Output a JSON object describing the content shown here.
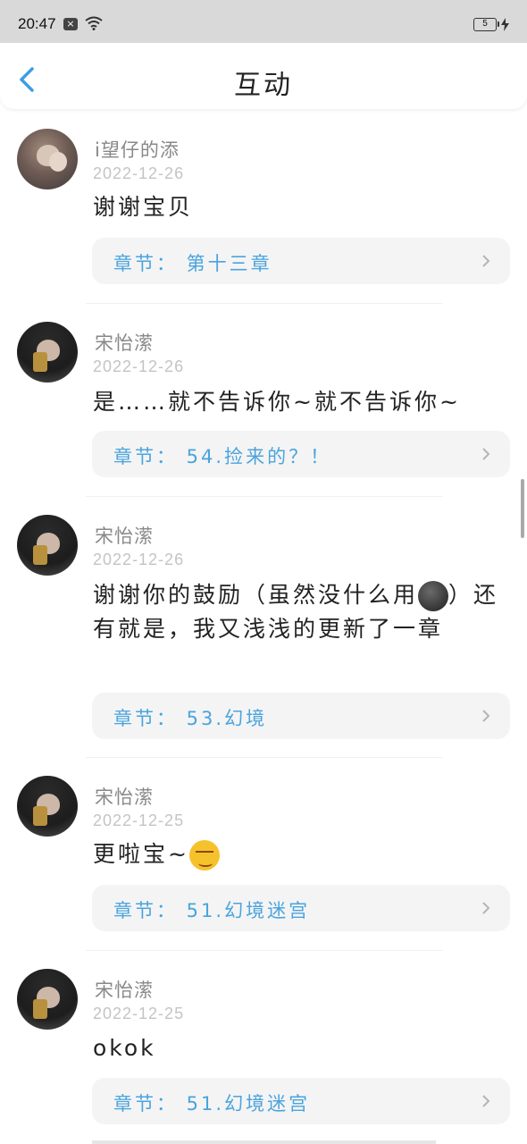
{
  "status_bar": {
    "time": "20:47",
    "notification_icon": "close-box-icon",
    "wifi_icon": "wifi-icon",
    "battery": "5",
    "charge_icon": "lightning-icon"
  },
  "header": {
    "title": "互动",
    "back_icon": "chevron-left-icon",
    "accent_color": "#3d9ee5"
  },
  "comments": [
    {
      "username": "i望仔的添",
      "date": "2022-12-26",
      "text": "谢谢宝贝",
      "chapter": "章节： 第十三章"
    },
    {
      "username": "宋怡潆",
      "date": "2022-12-26",
      "text": "是……就不告诉你~就不告诉你~",
      "chapter": "章节： 54.捡来的？！"
    },
    {
      "username": "宋怡潆",
      "date": "2022-12-26",
      "text_part1": "谢谢你的鼓励（虽然没什么用",
      "text_part2": "）还有就是，我又浅浅的更新了一章",
      "chapter": "章节： 53.幻境"
    },
    {
      "username": "宋怡潆",
      "date": "2022-12-25",
      "text": "更啦宝~",
      "chapter": "章节： 51.幻境迷宫"
    },
    {
      "username": "宋怡潆",
      "date": "2022-12-25",
      "text": "okok",
      "chapter": "章节： 51.幻境迷宫"
    }
  ],
  "colors": {
    "chapter_text": "#4aa4dc",
    "chapter_bg": "#f4f4f5",
    "username": "#888888",
    "date": "#c4c4c4"
  }
}
